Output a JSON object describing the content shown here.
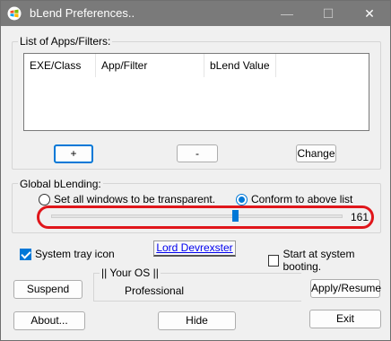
{
  "window": {
    "title": "bLend Preferences.."
  },
  "titlebar": {
    "minimize_glyph": "—",
    "maximize_glyph": "☐",
    "close_glyph": "✕"
  },
  "apps_group": {
    "label": "List of Apps/Filters:",
    "columns": [
      "EXE/Class",
      "App/Filter",
      "bLend Value"
    ],
    "rows": [],
    "add_label": "+",
    "remove_label": "-",
    "change_label": "Change"
  },
  "global_group": {
    "label": "Global bLending:",
    "radio_all_label": "Set all windows to be transparent.",
    "radio_all_selected": false,
    "radio_conform_label": "Conform to above list",
    "radio_conform_selected": true,
    "slider_value": "161",
    "slider_max": 255,
    "accent": "#0078d7",
    "highlight": "#e0161b"
  },
  "options": {
    "system_tray_label": "System tray icon",
    "system_tray_checked": true,
    "author_link": "Lord Devrexster",
    "startup_label": "Start at system booting.",
    "startup_checked": false
  },
  "os_group": {
    "label": "|| Your OS ||",
    "value": "Professional"
  },
  "buttons": {
    "suspend": "Suspend",
    "apply": "Apply/Resume",
    "about": "About...",
    "hide": "Hide",
    "exit": "Exit"
  },
  "icons": {
    "app": "windows-logo-icon"
  }
}
